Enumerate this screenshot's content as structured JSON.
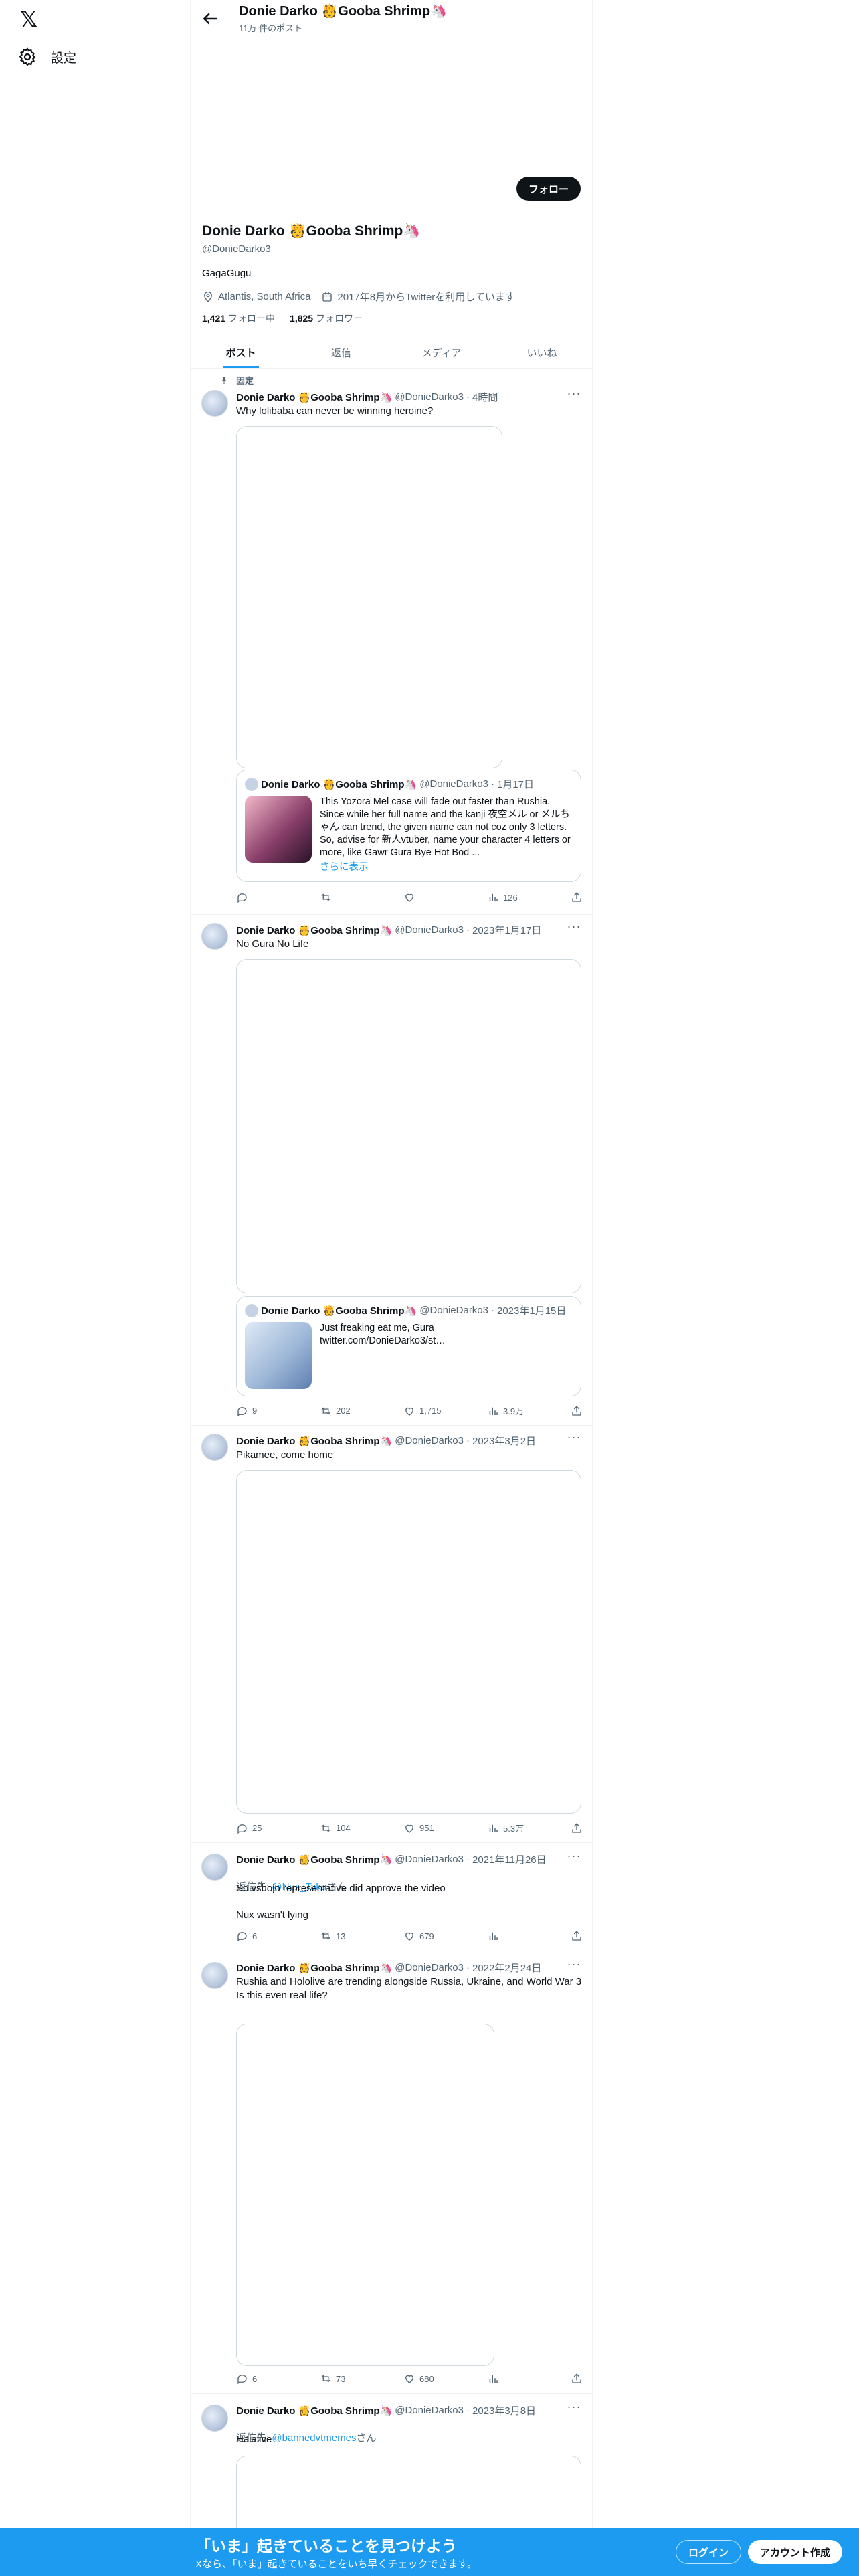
{
  "nav": {
    "logo": "𝕏",
    "settings_label": "設定"
  },
  "header": {
    "title": "Donie Darko 🫅Gooba Shrimp🦄",
    "post_count": "11万 件のポスト"
  },
  "profile": {
    "follow_label": "フォロー",
    "name": "Donie Darko 🫅Gooba Shrimp🦄",
    "handle": "@DonieDarko3",
    "bio": "GagaGugu",
    "location": "Atlantis, South Africa",
    "joined": "2017年8月からTwitterを利用しています",
    "following_count": "1,421",
    "following_label": "フォロー中",
    "followers_count": "1,825",
    "followers_label": "フォロワー"
  },
  "tabs": [
    {
      "label": "ポスト",
      "active": true
    },
    {
      "label": "返信",
      "active": false
    },
    {
      "label": "メディア",
      "active": false
    },
    {
      "label": "いいね",
      "active": false
    }
  ],
  "tweets": [
    {
      "pinned_label": "固定",
      "name": "Donie Darko 🫅Gooba Shrimp🦄",
      "handle": "@DonieDarko3",
      "sep": "·",
      "time": "4時間",
      "text": "Why lolibaba can never be winning heroine?",
      "quote": {
        "name": "Donie Darko 🫅Gooba Shrimp🦄",
        "handle": "@DonieDarko3",
        "time": "1月17日",
        "text": "This Yozora Mel case will fade out faster than Rushia. Since while her full name and the kanji 夜空メル or メルちゃん can trend, the given name can not coz only 3 letters. So, advise for 新人vtuber, name your character 4 letters or more, like Gawr Gura      Bye Hot Bod ...",
        "more": "さらに表示"
      },
      "replies": "",
      "retweets": "",
      "likes": "",
      "views": "126"
    },
    {
      "name": "Donie Darko 🫅Gooba Shrimp🦄",
      "handle": "@DonieDarko3",
      "sep": "·",
      "time": "2023年1月17日",
      "text": "No Gura No Life",
      "quote": {
        "name": "Donie Darko 🫅Gooba Shrimp🦄",
        "handle": "@DonieDarko3",
        "time": "2023年1月15日",
        "text": "Just freaking eat me, Gura\ntwitter.com/DonieDarko3/st…"
      },
      "replies": "9",
      "retweets": "202",
      "likes": "1,715",
      "views": "3.9万"
    },
    {
      "name": "Donie Darko 🫅Gooba Shrimp🦄",
      "handle": "@DonieDarko3",
      "sep": "·",
      "time": "2023年3月2日",
      "text": "Pikamee, come home",
      "replies": "25",
      "retweets": "104",
      "likes": "951",
      "views": "5.3万"
    },
    {
      "name": "Donie Darko 🫅Gooba Shrimp🦄",
      "handle": "@DonieDarko3",
      "sep": "·",
      "time": "2021年11月26日",
      "reply_prefix": "返信先: ",
      "reply_to": "@Nux_Taku",
      "reply_suffix": "さん",
      "text": "So vshojo representative did approve the video\n\nNux wasn't lying",
      "replies": "6",
      "retweets": "13",
      "likes": "679",
      "views": ""
    },
    {
      "name": "Donie Darko 🫅Gooba Shrimp🦄",
      "handle": "@DonieDarko3",
      "sep": "·",
      "time": "2022年2月24日",
      "text": "Rushia and Hololive are trending alongside Russia, Ukraine, and World War 3\nIs this even real life?",
      "replies": "6",
      "retweets": "73",
      "likes": "680",
      "views": ""
    },
    {
      "name": "Donie Darko 🫅Gooba Shrimp🦄",
      "handle": "@DonieDarko3",
      "sep": "·",
      "time": "2023年3月8日",
      "reply_prefix": "返信先: ",
      "reply_to": "@bannedvtmemes",
      "reply_suffix": "さん",
      "text": "Halalive"
    }
  ],
  "bottom": {
    "title": "「いま」起きていることを見つけよう",
    "subtitle": "Xなら、「いま」起きていることをいち早くチェックできます。",
    "login": "ログイン",
    "signup": "アカウント作成"
  },
  "colors": {
    "accent": "#1d9bf0",
    "text": "#0f1419",
    "muted": "#536471",
    "border": "#cfd9de"
  }
}
